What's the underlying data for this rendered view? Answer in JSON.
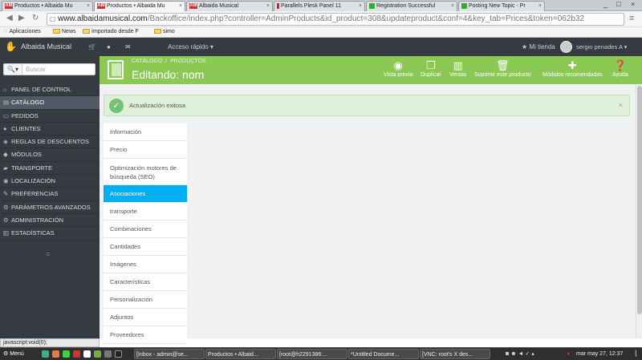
{
  "browser": {
    "tabs": [
      {
        "label": "Productos • Albaida Mu",
        "fav": "AM"
      },
      {
        "label": "Productos • Albaida Mu",
        "fav": "AM"
      },
      {
        "label": "Albaida Musical",
        "fav": "AM"
      },
      {
        "label": "Parallels Plesk Panel 11",
        "fav": "pl"
      },
      {
        "label": "Registration Successful",
        "fav": "gr"
      },
      {
        "label": "Posting New Topic - Pr",
        "fav": "gr"
      }
    ],
    "url_domain": "www.albaidamusical.com",
    "url_path": "/Backoffice/index.php?controller=AdminProducts&id_product=308&updateproduct&conf=4&key_tab=Prices&token=062b32",
    "bookmarks": [
      "Aplicaciones",
      "News",
      "Importado desde F",
      "simo"
    ]
  },
  "header": {
    "brand": "Albaida Musical",
    "quick": "Acceso rápido",
    "store": "Mi tienda",
    "user": "sergio penades A"
  },
  "sidebar": {
    "search_label": "Buscar",
    "items": [
      {
        "icon": "⌂",
        "label": "PANEL DE CONTROL"
      },
      {
        "icon": "▤",
        "label": "CATÁLOGO"
      },
      {
        "icon": "▭",
        "label": "PEDIDOS"
      },
      {
        "icon": "●",
        "label": "CLIENTES"
      },
      {
        "icon": "◈",
        "label": "REGLAS DE DESCUENTOS"
      },
      {
        "icon": "◆",
        "label": "MÓDULOS"
      },
      {
        "icon": "▰",
        "label": "TRANSPORTE"
      },
      {
        "icon": "◉",
        "label": "LOCALIZACIÓN"
      },
      {
        "icon": "✎",
        "label": "PREFERENCIAS"
      },
      {
        "icon": "⚙",
        "label": "PARÁMETROS AVANZADOS"
      },
      {
        "icon": "⚙",
        "label": "ADMINISTRACIÓN"
      },
      {
        "icon": "▥",
        "label": "ESTADÍSTICAS"
      }
    ]
  },
  "toolbar": {
    "breadcrumb1": "CATÁLOGO",
    "breadcrumb2": "PRODUCTOS",
    "title": "Editando: nom",
    "buttons": [
      "Vista previa",
      "Duplicar",
      "Ventas",
      "Suprimir este producto",
      "Módulos recomendados",
      "Ayuda"
    ]
  },
  "alert": "Actualización exitosa",
  "product_tabs": [
    "Información",
    "Precio",
    "Optimización motores de búsqueda (SEO)",
    "Asociaciones",
    "transporte",
    "Combinaciones",
    "Cantidades",
    "Imágenes",
    "Características",
    "Personalización",
    "Adjuntos",
    "Proveedores"
  ],
  "statusbar": "javascript:void(0);",
  "taskbar": {
    "menu": "Menú",
    "windows": [
      "[Inbox - admin@se...",
      "Productos • Albaid...",
      "[root@h2291386:...",
      "*Untitled Docume...",
      "[VNC: root's X des..."
    ],
    "clock": "mar may 27, 12:37"
  }
}
